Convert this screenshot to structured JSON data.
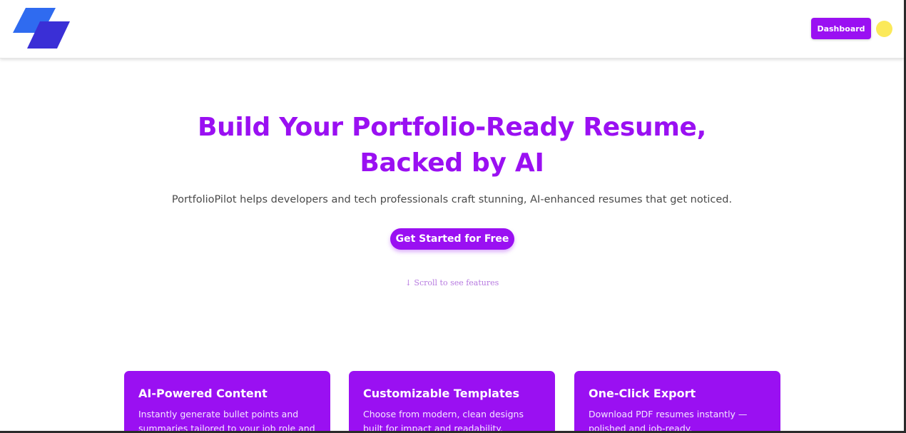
{
  "header": {
    "logo_icon": "parallelogram-logo-icon",
    "dashboard_label": "Dashboard",
    "avatar_color": "#fbe95a"
  },
  "hero": {
    "title_line1": "Build Your Portfolio-Ready Resume,",
    "title_line2": "Backed by AI",
    "subtitle": "PortfolioPilot helps developers and tech professionals craft stunning, AI-enhanced resumes that get noticed.",
    "cta_label": "Get Started for Free",
    "scroll_hint": "↓ Scroll to see features"
  },
  "features": [
    {
      "title": "AI-Powered Content",
      "text": "Instantly generate bullet points and summaries tailored to your job role and"
    },
    {
      "title": "Customizable Templates",
      "text": "Choose from modern, clean designs built for impact and readability."
    },
    {
      "title": "One-Click Export",
      "text": "Download PDF resumes instantly — polished and job-ready."
    }
  ],
  "colors": {
    "accent": "#9a10f2",
    "logo_light": "#2f6bf0",
    "logo_dark": "#3a2fd6",
    "background": "#ffffff"
  }
}
